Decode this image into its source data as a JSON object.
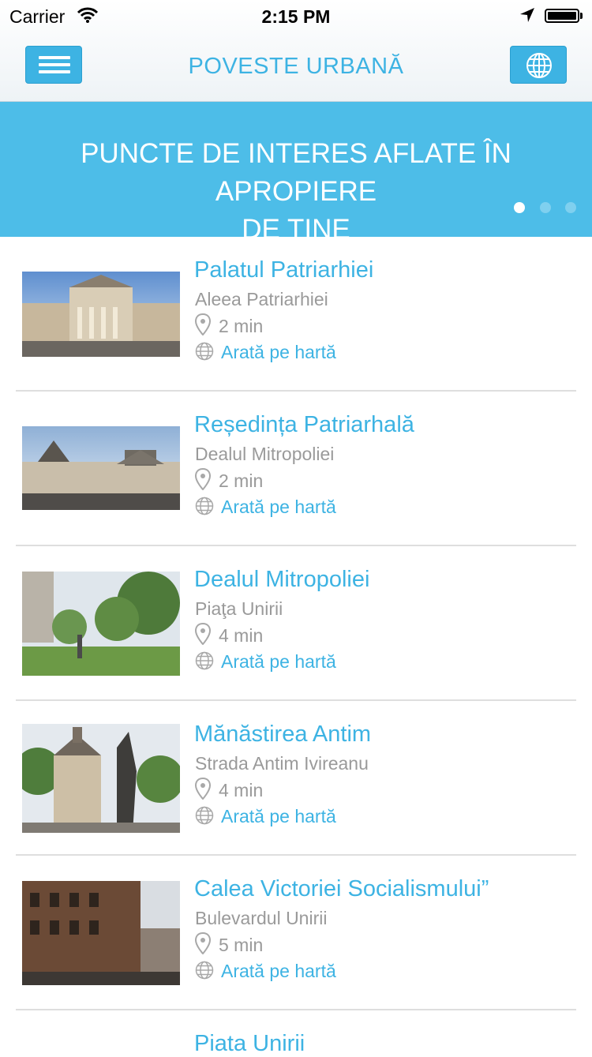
{
  "status_bar": {
    "carrier": "Carrier",
    "time": "2:15 PM"
  },
  "header": {
    "title": "POVESTE URBANĂ",
    "menu_icon": "hamburger-icon",
    "globe_icon": "globe-icon"
  },
  "banner": {
    "title_line1": "PUNCTE DE INTERES AFLATE ÎN APROPIERE",
    "title_line2": "DE TINE",
    "page_count": 3,
    "active_page": 1
  },
  "list": {
    "items": [
      {
        "name": "Palatul Patriarhiei",
        "address": "Aleea Patriarhiei",
        "time": "2 min",
        "map_link": "Arată pe hartă"
      },
      {
        "name": "Reședința Patriarhală",
        "address": "Dealul Mitropoliei",
        "time": "2 min",
        "map_link": "Arată pe hartă"
      },
      {
        "name": "Dealul Mitropoliei",
        "address": "Piaţa Unirii",
        "time": "4 min",
        "map_link": "Arată pe hartă"
      },
      {
        "name": "Mănăstirea Antim",
        "address": "Strada Antim Ivireanu",
        "time": "4 min",
        "map_link": "Arată pe hartă"
      },
      {
        "name": "Calea Victoriei Socialismului”",
        "address": "Bulevardul Unirii",
        "time": "5 min",
        "map_link": "Arată pe hartă"
      },
      {
        "name": "Piata Unirii"
      }
    ]
  },
  "colors": {
    "accent": "#3db3e3",
    "banner": "#4dbde8",
    "muted_text": "#9a9a9a"
  }
}
